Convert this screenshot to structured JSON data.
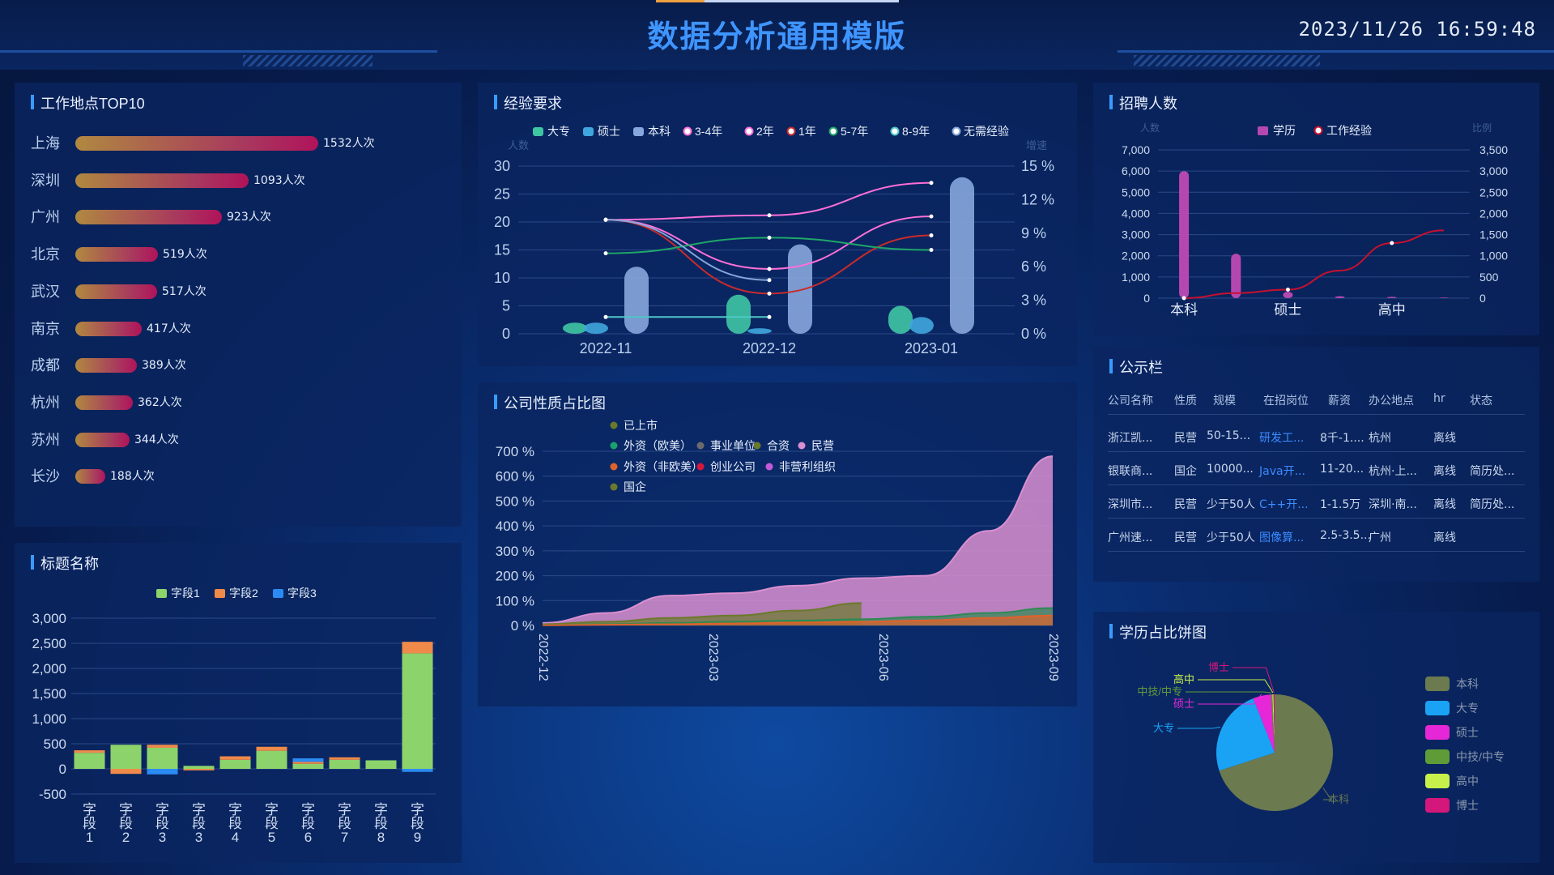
{
  "header": {
    "title": "数据分析通用模版",
    "datetime": "2023/11/26 16:59:48"
  },
  "top10": {
    "title": "工作地点TOP10",
    "unit_suffix": "人次",
    "items": [
      {
        "city": "上海",
        "value": 1532
      },
      {
        "city": "深圳",
        "value": 1093
      },
      {
        "city": "广州",
        "value": 923
      },
      {
        "city": "北京",
        "value": 519
      },
      {
        "city": "武汉",
        "value": 517
      },
      {
        "city": "南京",
        "value": 417
      },
      {
        "city": "成都",
        "value": 389
      },
      {
        "city": "杭州",
        "value": 362
      },
      {
        "city": "苏州",
        "value": 344
      },
      {
        "city": "长沙",
        "value": 188
      }
    ],
    "colors": {
      "start": "#b08840",
      "end": "#b0135a"
    }
  },
  "experience": {
    "title": "经验要求",
    "ylabel_left": "人数",
    "ylabel_right": "增速"
  },
  "recruit": {
    "title": "招聘人数",
    "ylabel_left": "人数",
    "ylabel_right": "比例"
  },
  "company": {
    "title": "公司性质占比图"
  },
  "titlechart": {
    "title": "标题名称"
  },
  "notice": {
    "title": "公示栏",
    "headers": [
      "公司名称",
      "性质",
      "规模",
      "在招岗位",
      "薪资",
      "办公地点",
      "hr",
      "状态"
    ],
    "rows": [
      [
        "浙江凯...",
        "民营",
        "50-15...",
        "研发工...",
        "8千-1....",
        "杭州",
        "离线",
        ""
      ],
      [
        "银联商...",
        "国企",
        "10000...",
        "Java开...",
        "11-20...",
        "杭州·上...",
        "离线",
        "简历处..."
      ],
      [
        "深圳市...",
        "民营",
        "少于50人",
        "C++开...",
        "1-1.5万",
        "深圳·南...",
        "离线",
        "简历处..."
      ],
      [
        "广州速...",
        "民营",
        "少于50人",
        "图像算...",
        "2.5-3.5...",
        "广州",
        "离线",
        ""
      ]
    ]
  },
  "education": {
    "title": "学历占比饼图"
  },
  "chart_data": [
    {
      "id": "experience",
      "type": "bar+line",
      "categories": [
        "2022-11",
        "2022-12",
        "2023-01"
      ],
      "bar_series": [
        {
          "name": "大专",
          "values": [
            2,
            7,
            5
          ],
          "color": "#3ec6a3"
        },
        {
          "name": "硕士",
          "values": [
            2,
            1,
            3
          ],
          "color": "#3fa7dd"
        },
        {
          "name": "本科",
          "values": [
            12,
            16,
            28
          ],
          "color": "#86a7dd"
        }
      ],
      "line_series": [
        {
          "name": "3-4年",
          "values": [
            10.2,
            10.6,
            13.5
          ],
          "color": "#ff6fd8"
        },
        {
          "name": "2年",
          "values": [
            10.2,
            5.8,
            10.5
          ],
          "color": "#ff6fd8"
        },
        {
          "name": "1年",
          "values": [
            10.2,
            3.6,
            8.8
          ],
          "color": "#c92b2b"
        },
        {
          "name": "5-7年",
          "values": [
            7.2,
            8.6,
            7.5
          ],
          "color": "#1fa66a"
        },
        {
          "name": "8-9年",
          "values": [
            1.5,
            1.5,
            null
          ],
          "color": "#4fc6c6"
        },
        {
          "name": "无需经验",
          "values": [
            10.2,
            4.8,
            null
          ],
          "color": "#86a7dd"
        }
      ],
      "yleft": [
        0,
        30
      ],
      "yleft_ticks": [
        0,
        5,
        10,
        15,
        20,
        25,
        30
      ],
      "yright": [
        0,
        15
      ],
      "yright_ticks": [
        "0 %",
        "3 %",
        "6 %",
        "9 %",
        "12 %",
        "15 %"
      ]
    },
    {
      "id": "recruit",
      "type": "bar+line",
      "categories": [
        "本科",
        "硕士",
        "高中"
      ],
      "bar_series": [
        {
          "name": "学历",
          "values": [
            6000,
            2100,
            300,
            90,
            60,
            30
          ],
          "color": "#b548b0"
        }
      ],
      "line_series": [
        {
          "name": "工作经验",
          "values": [
            0,
            120,
            200,
            650,
            1300,
            1600
          ],
          "color": "#c8102e"
        }
      ],
      "yleft": [
        0,
        7000
      ],
      "yleft_ticks": [
        "0",
        "1,000",
        "2,000",
        "3,000",
        "4,000",
        "5,000",
        "6,000",
        "7,000"
      ],
      "yright": [
        0,
        3500
      ],
      "yright_ticks": [
        "0",
        "500",
        "1,000",
        "1,500",
        "2,000",
        "2,500",
        "3,000",
        "3,500"
      ]
    },
    {
      "id": "company",
      "type": "area",
      "x_ticks": [
        "2022-12",
        "2023-03",
        "2023-06",
        "2023-09"
      ],
      "legend": [
        "已上市",
        "外资（欧美）",
        "事业单位",
        "合资",
        "民营",
        "外资（非欧美）",
        "创业公司",
        "非营利组织",
        "国企"
      ],
      "series": [
        {
          "name": "民营",
          "values": [
            10,
            50,
            120,
            130,
            160,
            190,
            200,
            380,
            680
          ],
          "color": "#d98fd0"
        },
        {
          "name": "已上市",
          "values": [
            5,
            15,
            30,
            40,
            60,
            90,
            null,
            null,
            null
          ],
          "color": "#6b7a2a"
        },
        {
          "name": "合资",
          "values": [
            2,
            5,
            10,
            15,
            20,
            25,
            35,
            50,
            70
          ],
          "color": "#2d8a52"
        },
        {
          "name": "外资（非欧美）",
          "values": [
            1,
            3,
            5,
            8,
            12,
            15,
            20,
            30,
            40
          ],
          "color": "#e0622a"
        }
      ],
      "y_ticks": [
        "0 %",
        "100 %",
        "200 %",
        "300 %",
        "400 %",
        "500 %",
        "600 %",
        "700 %"
      ],
      "ylim": [
        0,
        700
      ]
    },
    {
      "id": "titlechart",
      "type": "bar",
      "categories": [
        "字段1",
        "字段2",
        "字段3",
        "字段3",
        "字段4",
        "字段5",
        "字段6",
        "字段7",
        "字段8",
        "字段9"
      ],
      "series": [
        {
          "name": "字段1",
          "values": [
            320,
            480,
            420,
            60,
            180,
            360,
            100,
            180,
            170,
            2300
          ],
          "color": "#8dd36b"
        },
        {
          "name": "字段2",
          "values": [
            50,
            -100,
            60,
            -30,
            70,
            80,
            40,
            50,
            0,
            230
          ],
          "color": "#ef8a4a"
        },
        {
          "name": "字段3",
          "values": [
            0,
            0,
            -110,
            0,
            0,
            0,
            70,
            0,
            0,
            -60
          ],
          "color": "#2b8bf2"
        }
      ],
      "ylim": [
        -500,
        3000
      ],
      "y_ticks": [
        "-500",
        "0",
        "500",
        "1,000",
        "1,500",
        "2,000",
        "2,500",
        "3,000"
      ]
    },
    {
      "id": "education",
      "type": "pie",
      "slices": [
        {
          "name": "本科",
          "value": 70.0,
          "color": "#6b7a4f"
        },
        {
          "name": "大专",
          "value": 24.0,
          "color": "#1aa3f5"
        },
        {
          "name": "硕士",
          "value": 5.0,
          "color": "#e627d7"
        },
        {
          "name": "中技/中专",
          "value": 0.4,
          "color": "#5f9c38"
        },
        {
          "name": "高中",
          "value": 0.3,
          "color": "#c8f04a"
        },
        {
          "name": "博士",
          "value": 0.3,
          "color": "#d4177a"
        }
      ]
    }
  ]
}
